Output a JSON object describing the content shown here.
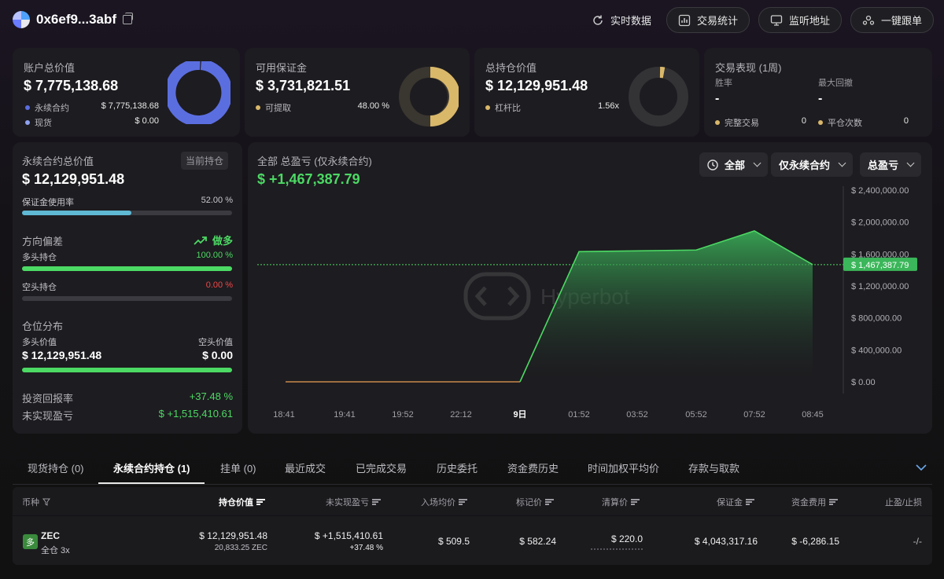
{
  "header": {
    "address": "0x6ef9...3abf",
    "buttons": {
      "realtime": "实时数据",
      "trade_stats": "交易统计",
      "watch_address": "监听地址",
      "copy_trade": "一键跟单"
    }
  },
  "cards": {
    "account": {
      "title": "账户总价值",
      "value": "$ 7,775,138.68",
      "legend": [
        {
          "label": "永续合约",
          "value": "$ 7,775,138.68",
          "color": "#5b6ee0"
        },
        {
          "label": "现货",
          "value": "$ 0.00",
          "color": "#8ea2f0"
        }
      ]
    },
    "margin": {
      "title": "可用保证金",
      "value": "$ 3,731,821.51",
      "legend": [
        {
          "label": "可提取",
          "value": "48.00 %",
          "color": "#d9b86a"
        }
      ],
      "fraction": 0.48
    },
    "position": {
      "title": "总持仓价值",
      "value": "$ 12,129,951.48",
      "legend": [
        {
          "label": "杠杆比",
          "value": "1.56x",
          "color": "#d9b86a"
        }
      ]
    },
    "performance": {
      "title": "交易表现 (1周)",
      "win_rate_label": "胜率",
      "win_rate_value": "-",
      "max_drawdown_label": "最大回撤",
      "max_drawdown_value": "-",
      "completed_label": "完整交易",
      "completed_value": "0",
      "close_count_label": "平仓次数",
      "close_count_value": "0"
    }
  },
  "perp_panel": {
    "title": "永续合约总价值",
    "tag": "当前持仓",
    "value": "$ 12,129,951.48",
    "margin_usage_label": "保证金使用率",
    "margin_usage_value": "52.00 %",
    "margin_usage_fraction": 0.52,
    "direction_label": "方向偏差",
    "direction_value": "做多",
    "long_label": "多头持仓",
    "long_value": "100.00 %",
    "long_fraction": 1.0,
    "short_label": "空头持仓",
    "short_value": "0.00 %",
    "short_fraction": 0.0,
    "distribution_label": "仓位分布",
    "long_value_label": "多头价值",
    "long_value_amount": "$ 12,129,951.48",
    "short_value_label": "空头价值",
    "short_value_amount": "$ 0.00",
    "roi_label": "投资回报率",
    "roi_value": "+37.48 %",
    "unrealized_label": "未实现盈亏",
    "unrealized_value": "$ +1,515,410.61"
  },
  "chart_panel": {
    "title": "全部 总盈亏 (仅永续合约)",
    "value": "$ +1,467,387.79",
    "dropdowns": {
      "range": "全部",
      "scope": "仅永续合约",
      "metric": "总盈亏"
    },
    "watermark": "Hyperbot"
  },
  "chart_data": {
    "type": "area",
    "x": [
      "18:41",
      "19:41",
      "19:52",
      "22:12",
      "9日",
      "01:52",
      "03:52",
      "05:52",
      "07:52",
      "08:45"
    ],
    "values": [
      0,
      0,
      0,
      0,
      0,
      1630000,
      1640000,
      1650000,
      1890000,
      1467387.79
    ],
    "ylim": [
      0,
      2400000
    ],
    "y_ticks": [
      "$ 0.00",
      "$ 400,000.00",
      "$ 800,000.00",
      "$ 1,200,000.00",
      "$ 1,600,000.00",
      "$ 2,000,000.00",
      "$ 2,400,000.00"
    ],
    "y_tick_values": [
      0,
      400000,
      800000,
      1200000,
      1600000,
      2000000,
      2400000
    ],
    "current_label": "$ 1,467,387.79",
    "current_value": 1467387.79
  },
  "tabs": [
    {
      "label": "现货持仓 (0)"
    },
    {
      "label": "永续合约持仓 (1)"
    },
    {
      "label": "挂单 (0)"
    },
    {
      "label": "最近成交"
    },
    {
      "label": "已完成交易"
    },
    {
      "label": "历史委托"
    },
    {
      "label": "资金费历史"
    },
    {
      "label": "时间加权平均价"
    },
    {
      "label": "存款与取款"
    }
  ],
  "table": {
    "headers": [
      "币种",
      "持仓价值",
      "未实现盈亏",
      "入场均价",
      "标记价",
      "清算价",
      "保证金",
      "资金费用",
      "止盈/止损"
    ],
    "row": {
      "badge": "多",
      "coin": "ZEC",
      "mode": "全仓 3x",
      "value": "$ 12,129,951.48",
      "size": "20,833.25 ZEC",
      "pnl": "$ +1,515,410.61",
      "pnl_pct": "+37.48 %",
      "entry": "$ 509.5",
      "mark": "$ 582.24",
      "liq": "$ 220.0",
      "margin": "$ 4,043,317.16",
      "funding": "$ -6,286.15",
      "tpsl": "-/-"
    }
  }
}
